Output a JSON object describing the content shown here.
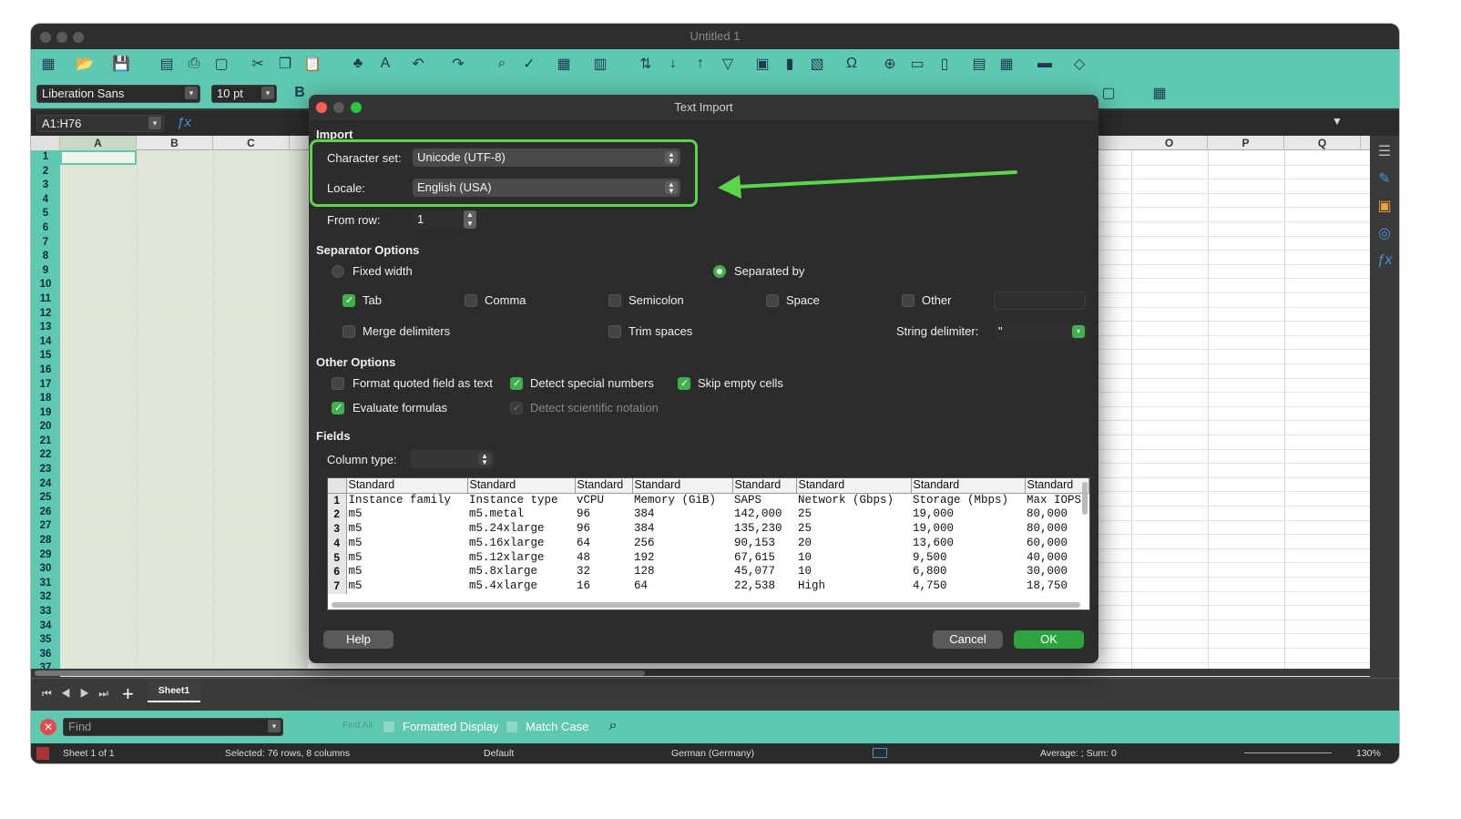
{
  "window": {
    "title": "Untitled 1"
  },
  "toolbar": {
    "font_name": "Liberation Sans",
    "font_size": "10 pt"
  },
  "formula_bar": {
    "name_box": "A1:H76"
  },
  "sheet": {
    "columns_left": [
      "A",
      "B",
      "C"
    ],
    "columns_right": [
      "O",
      "P",
      "Q"
    ],
    "rows": [
      "1",
      "2",
      "3",
      "4",
      "5",
      "6",
      "7",
      "8",
      "9",
      "10",
      "11",
      "12",
      "13",
      "14",
      "15",
      "16",
      "17",
      "18",
      "19",
      "20",
      "21",
      "22",
      "23",
      "24",
      "25",
      "26",
      "27",
      "28",
      "29",
      "30",
      "31",
      "32",
      "33",
      "34",
      "35",
      "36",
      "37"
    ]
  },
  "tabs": {
    "sheet1": "Sheet1"
  },
  "findbar": {
    "placeholder": "Find",
    "find_all": "Find All",
    "formatted_display": "Formatted Display",
    "match_case": "Match Case"
  },
  "status": {
    "sheet": "Sheet 1 of 1",
    "selected": "Selected: 76 rows, 8 columns",
    "style": "Default",
    "language": "German (Germany)",
    "stats": "Average: ; Sum: 0",
    "zoom": "130%"
  },
  "dialog": {
    "title": "Text Import",
    "import_heading": "Import",
    "charset_label": "Character set:",
    "charset_value": "Unicode (UTF-8)",
    "locale_label": "Locale:",
    "locale_value": "English (USA)",
    "from_row_label": "From row:",
    "from_row_value": "1",
    "sep_heading": "Separator Options",
    "fixed_width": "Fixed width",
    "separated_by": "Separated by",
    "tab": "Tab",
    "comma": "Comma",
    "semicolon": "Semicolon",
    "space": "Space",
    "other": "Other",
    "merge": "Merge delimiters",
    "trim": "Trim spaces",
    "string_delim_label": "String delimiter:",
    "string_delim_value": "\"",
    "other_heading": "Other Options",
    "quoted": "Format quoted field as text",
    "detect_special": "Detect special numbers",
    "skip_empty": "Skip empty cells",
    "eval": "Evaluate formulas",
    "detect_sci": "Detect scientific notation",
    "fields_heading": "Fields",
    "column_type_label": "Column type:",
    "help": "Help",
    "cancel": "Cancel",
    "ok": "OK"
  },
  "preview": {
    "headers": [
      "Standard",
      "Standard",
      "Standard",
      "Standard",
      "Standard",
      "Standard",
      "Standard",
      "Standard"
    ],
    "rows": [
      [
        "1",
        "Instance family",
        "Instance type",
        "vCPU",
        "Memory (GiB)",
        "SAPS",
        "Network (Gbps)",
        "Storage (Mbps)",
        "Max IOPS"
      ],
      [
        "2",
        "m5",
        "m5.metal",
        "96",
        "384",
        "142,000",
        "25",
        "19,000",
        "80,000"
      ],
      [
        "3",
        "m5",
        "m5.24xlarge",
        "96",
        "384",
        "135,230",
        "25",
        "19,000",
        "80,000"
      ],
      [
        "4",
        "m5",
        "m5.16xlarge",
        "64",
        "256",
        "90,153",
        "20",
        "13,600",
        "60,000"
      ],
      [
        "5",
        "m5",
        "m5.12xlarge",
        "48",
        "192",
        "67,615",
        "10",
        "9,500",
        "40,000"
      ],
      [
        "6",
        "m5",
        "m5.8xlarge",
        "32",
        "128",
        "45,077",
        "10",
        "6,800",
        "30,000"
      ],
      [
        "7",
        "m5",
        "m5.4xlarge",
        "16",
        "64",
        "22,538",
        "High",
        "4,750",
        "18,750"
      ]
    ]
  },
  "colors": {
    "accent": "#5ec8b0",
    "highlight": "#5bd64b",
    "ok": "#2ea23f"
  }
}
